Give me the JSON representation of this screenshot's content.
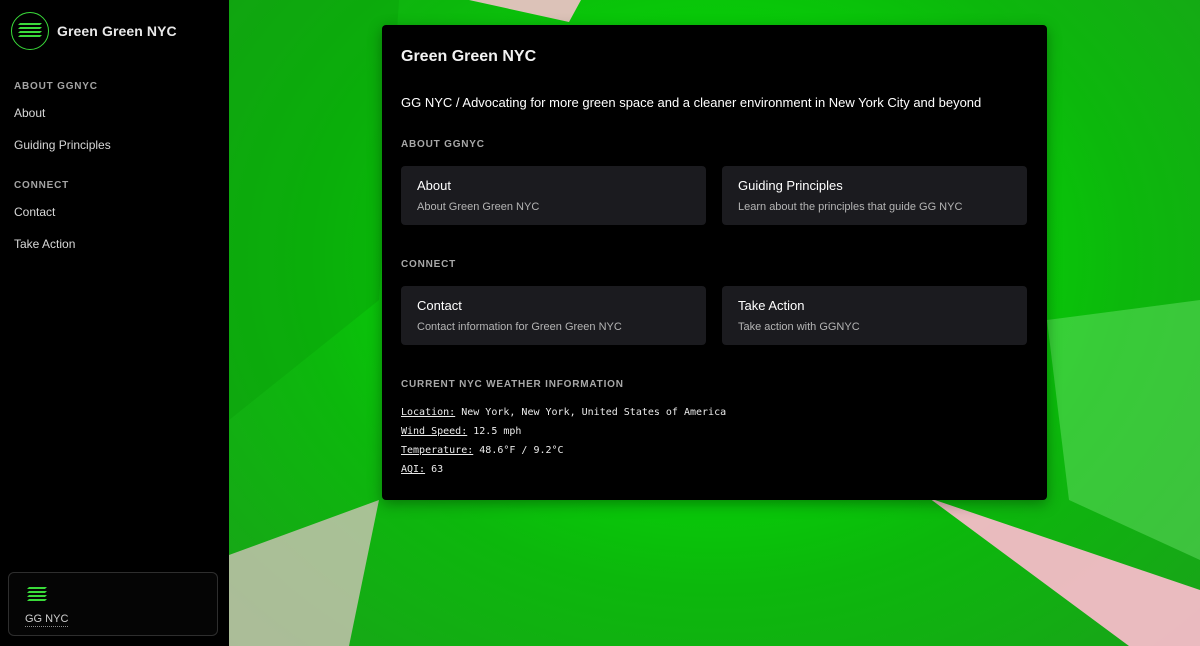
{
  "colors": {
    "accent": "#3adb3a",
    "bg_green": "#00e800",
    "bg_pink": "#f5bcc8",
    "tile": "#1b1b1f"
  },
  "sidebar": {
    "logo_icon": "green-stripes-logo-icon",
    "title": "Green Green NYC",
    "sections": [
      {
        "heading": "ABOUT GGNYC",
        "items": [
          {
            "label": "About"
          },
          {
            "label": "Guiding Principles"
          }
        ]
      },
      {
        "heading": "CONNECT",
        "items": [
          {
            "label": "Contact"
          },
          {
            "label": "Take Action"
          }
        ]
      }
    ],
    "footer": {
      "label": "GG NYC"
    }
  },
  "main": {
    "title": "Green Green NYC",
    "subtitle": "GG NYC / Advocating for more green space and a cleaner environment in New York City and beyond",
    "sections": [
      {
        "heading": "ABOUT GGNYC",
        "tiles": [
          {
            "title": "About",
            "desc": "About Green Green NYC"
          },
          {
            "title": "Guiding Principles",
            "desc": "Learn about the principles that guide GG NYC"
          }
        ]
      },
      {
        "heading": "CONNECT",
        "tiles": [
          {
            "title": "Contact",
            "desc": "Contact information for Green Green NYC"
          },
          {
            "title": "Take Action",
            "desc": "Take action with GGNYC"
          }
        ]
      }
    ],
    "weather": {
      "heading": "CURRENT NYC WEATHER INFORMATION",
      "rows": [
        {
          "key": "Location:",
          "value": "New York, New York, United States of America"
        },
        {
          "key": "Wind Speed:",
          "value": "12.5 mph"
        },
        {
          "key": "Temperature:",
          "value": "48.6°F / 9.2°C"
        },
        {
          "key": "AQI:",
          "value": "63"
        }
      ]
    }
  }
}
